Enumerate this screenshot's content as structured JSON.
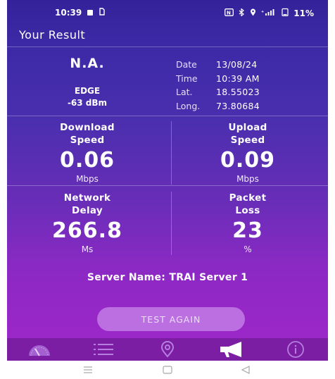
{
  "status_bar": {
    "time": "10:39",
    "battery": "11%",
    "icons": [
      "notification-square-icon",
      "sim-icon",
      "nfc-icon",
      "bluetooth-icon",
      "location-icon",
      "signal-icon",
      "battery-icon"
    ]
  },
  "header": {
    "title": "Your Result"
  },
  "network": {
    "operator": "N.A.",
    "technology": "EDGE",
    "signal": "-63 dBm"
  },
  "info": [
    {
      "label": "Date",
      "value": "13/08/24"
    },
    {
      "label": "Time",
      "value": "10:39 AM"
    },
    {
      "label": "Lat.",
      "value": "18.55023"
    },
    {
      "label": "Long.",
      "value": "73.80684"
    }
  ],
  "metrics": {
    "download": {
      "label_line1": "Download",
      "label_line2": "Speed",
      "value": "0.06",
      "unit": "Mbps"
    },
    "upload": {
      "label_line1": "Upload",
      "label_line2": "Speed",
      "value": "0.09",
      "unit": "Mbps"
    },
    "delay": {
      "label_line1": "Network",
      "label_line2": "Delay",
      "value": "266.8",
      "unit": "Ms"
    },
    "loss": {
      "label_line1": "Packet",
      "label_line2": "Loss",
      "value": "23",
      "unit": "%"
    }
  },
  "server": {
    "text": "Server Name: TRAI Server 1"
  },
  "actions": {
    "test_again": "TEST AGAIN"
  },
  "tabs": [
    {
      "name": "speedometer-icon"
    },
    {
      "name": "list-icon"
    },
    {
      "name": "location-pin-icon"
    },
    {
      "name": "megaphone-icon"
    },
    {
      "name": "info-icon"
    }
  ],
  "colors": {
    "background_top": "#34229a",
    "background_bottom": "#9a27c8",
    "tab_bar": "#7c1ea4",
    "button": "#bb6fe0"
  }
}
